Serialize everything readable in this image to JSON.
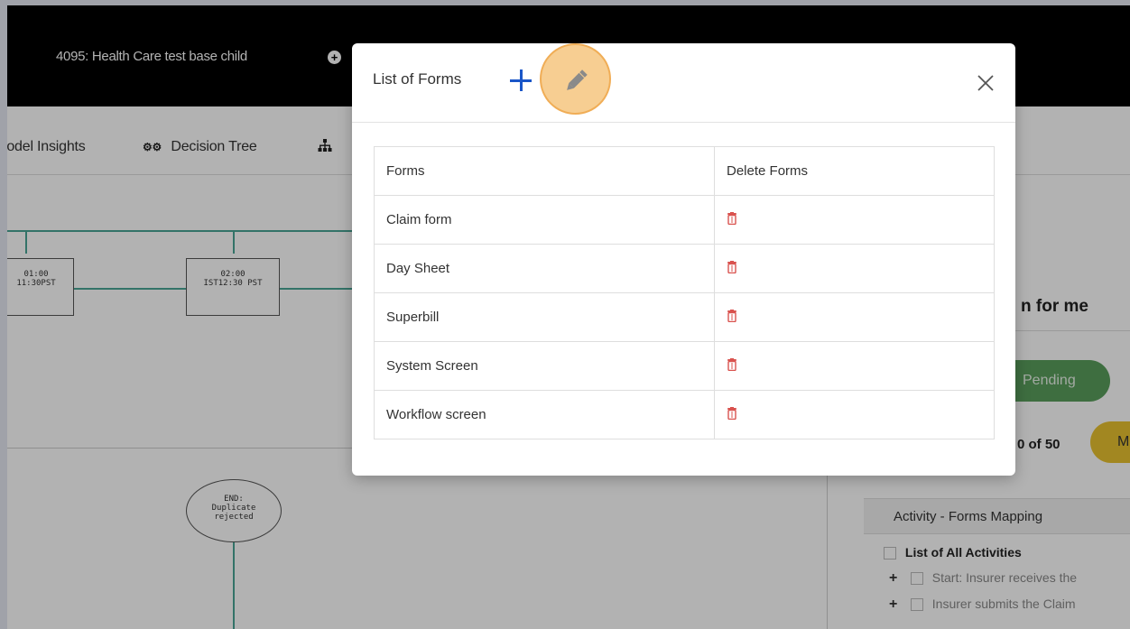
{
  "app": {
    "title": "4095: Health Care test base child"
  },
  "nav": {
    "items": [
      {
        "label": "lodel Insights",
        "icon": "none"
      },
      {
        "label": "Decision Tree",
        "icon": "gears-icon"
      },
      {
        "label": "",
        "icon": "hierarchy-icon"
      }
    ]
  },
  "flow": {
    "box1": [
      "01:00",
      "11:30PST"
    ],
    "box2": [
      "02:00",
      "IST12:30 PST"
    ],
    "end_node": [
      "END:",
      "Duplicate",
      "rejected"
    ]
  },
  "right_panel": {
    "title_fragment": "n for me",
    "pending_label": "Pending",
    "count_label": "0 of 50",
    "m_button_label": "M",
    "activity_header": "Activity - Forms Mapping",
    "activities": [
      {
        "label": "List of All Activities",
        "bold": true
      },
      {
        "label": "Start: Insurer receives the",
        "bold": false
      },
      {
        "label": "Insurer submits the Claim",
        "bold": false
      }
    ]
  },
  "modal": {
    "title": "List of Forms",
    "add_icon": "plus-icon",
    "edit_icon": "pencil-icon",
    "close_icon": "close-icon",
    "columns": [
      "Forms",
      "Delete Forms"
    ],
    "rows": [
      {
        "name": "Claim form"
      },
      {
        "name": "Day Sheet"
      },
      {
        "name": "Superbill"
      },
      {
        "name": "System Screen"
      },
      {
        "name": "Workflow screen"
      }
    ]
  },
  "colors": {
    "topbar": "#000000",
    "accent_blue": "#1a56c8",
    "flow_line": "#4aa595",
    "pending_green": "#5a9e5c",
    "m_yellow": "#e8c230",
    "delete_red": "#d9534f",
    "edit_highlight": "#f4be6e"
  }
}
